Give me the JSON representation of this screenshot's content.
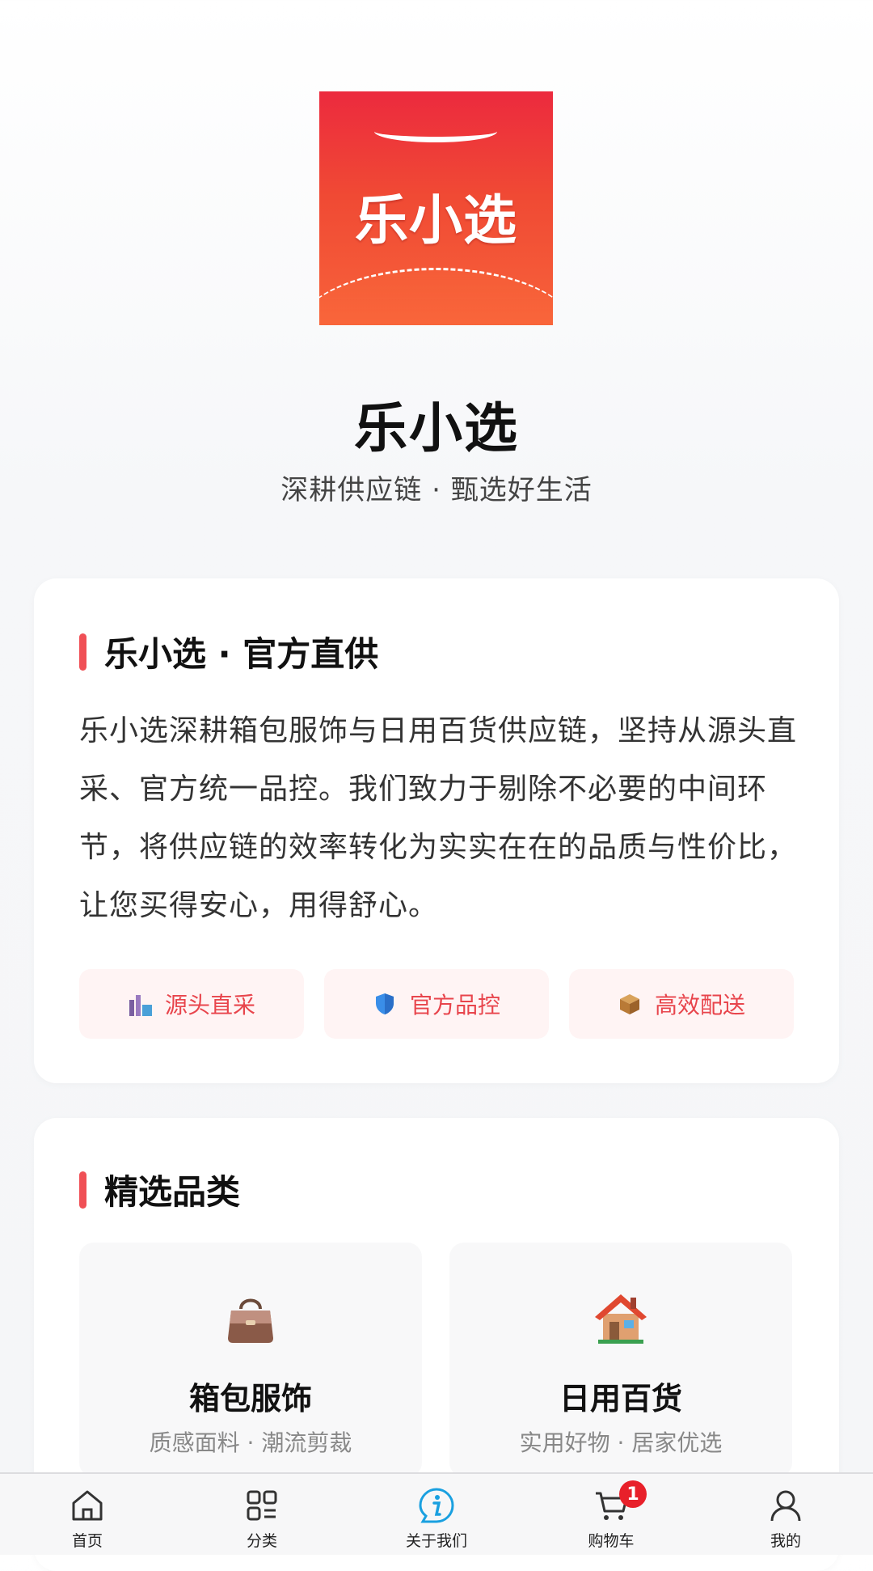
{
  "brand": {
    "logo_text": "乐小选",
    "name": "乐小选",
    "slogan": "深耕供应链 · 甄选好生活",
    "accent_color": "#e8454c"
  },
  "about": {
    "title": "乐小选 · 官方直供",
    "body": "乐小选深耕箱包服饰与日用百货供应链，坚持从源头直采、官方统一品控。我们致力于剔除不必要的中间环节，将供应链的效率转化为实实在在的品质与性价比，让您买得安心，用得舒心。",
    "features": [
      {
        "icon": "factory-icon",
        "label": "源头直采"
      },
      {
        "icon": "shield-icon",
        "label": "官方品控"
      },
      {
        "icon": "package-icon",
        "label": "高效配送"
      }
    ]
  },
  "categories": {
    "title": "精选品类",
    "items": [
      {
        "icon": "handbag-icon",
        "name": "箱包服饰",
        "desc": "质感面料 · 潮流剪裁"
      },
      {
        "icon": "house-icon",
        "name": "日用百货",
        "desc": "实用好物 · 居家优选"
      }
    ]
  },
  "tabbar": {
    "items": [
      {
        "icon": "home-icon",
        "label": "首页"
      },
      {
        "icon": "category-icon",
        "label": "分类"
      },
      {
        "icon": "info-icon",
        "label": "关于我们",
        "active": true
      },
      {
        "icon": "cart-icon",
        "label": "购物车",
        "badge": "1"
      },
      {
        "icon": "user-icon",
        "label": "我的"
      }
    ]
  }
}
